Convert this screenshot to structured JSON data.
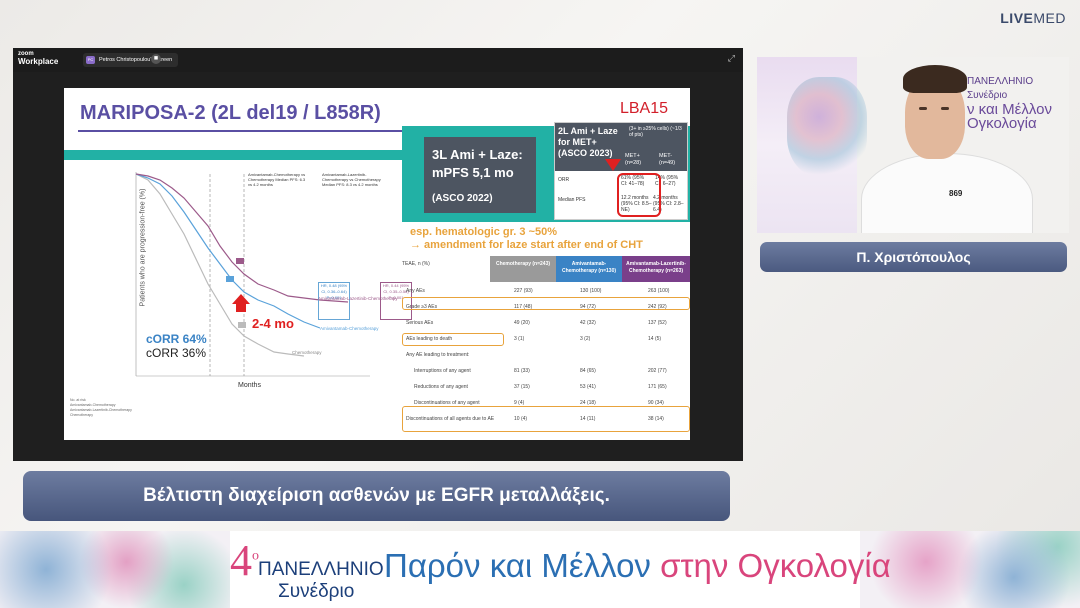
{
  "brand": {
    "logo_bold": "LIVE",
    "logo_light": "MED"
  },
  "zoom": {
    "app_logo_top": "zoom",
    "app_logo_bottom": "Workplace",
    "share_initials": "PC",
    "share_label": "Petros Christopoulou's screen",
    "stop_icon": "stop-icon",
    "expand_icon": "expand-icon"
  },
  "slide": {
    "title": "MARIPOSA-2 (2L del19 / L858R)",
    "lba": "LBA15",
    "box3l": {
      "line1": "3L Ami + Laze:",
      "line2": "mPFS 5,1 mo",
      "line3": "(ASCO 2022)"
    },
    "met": {
      "title": "2L Ami + Laze for MET+ (ASCO 2023)",
      "subtitle": "(3+ in ≥25% cells) (~1/3 of pts)",
      "col1": "MET+ (n=28)",
      "col2": "MET- (n=49)",
      "row1_label": "ORR",
      "row1_v1": "61% (95% CI: 41–78)",
      "row1_v2": "14% (95% CI: 6–27)",
      "row2_label": "Median PFS",
      "row2_v1": "12.2 months (95% CI: 8.5–NE)",
      "row2_v2": "4.2 months (95% CI: 2.8–6.4)"
    },
    "note": {
      "line1": "esp. hematologic gr. 3 ~50%",
      "line2": "→ amendment for laze start after end of CHT"
    },
    "km": {
      "ylabel": "Patients who are progression-free (%)",
      "xlabel": "Months",
      "corr1": "cORR 64%",
      "corr2": "cORR 36%",
      "mo": "2-4 mo",
      "leg1": "Amivantamab-Chemotherapy vs Chemotherapy Median PFS: 6.3 vs 4.2 months",
      "leg2": "Amivantamab-Lazertinib-Chemotherapy vs Chemotherapy Median PFS: 8.3 vs 4.2 months",
      "hr1": "HR, 0.48 (95% CI, 0.36–0.64) P<0.001",
      "hr2": "HR, 0.44 (95% CI, 0.35–0.56) P<0.001",
      "curve_alc": "Amivantamab-Lazertinib-Chemotherapy",
      "curve_ac": "Amivantamab-Chemotherapy",
      "curve_c": "Chemotherapy",
      "risk_title": "No. at risk",
      "risk_rows": [
        "Amivantamab-Chemotherapy",
        "Amivantamab-Lazertinib-Chemotherapy",
        "Chemotherapy"
      ]
    },
    "teae": {
      "h0": "TEAE, n (%)",
      "h1": "Chemotherapy (n=243)",
      "h2": "Amivantamab-Chemotherapy (n=130)",
      "h3": "Amivantamab-Lazertinib-Chemotherapy (n=263)",
      "rows": [
        [
          "Any AEs",
          "227 (93)",
          "130 (100)",
          "263 (100)"
        ],
        [
          "Grade ≥3 AEs",
          "117 (48)",
          "94 (72)",
          "242 (92)"
        ],
        [
          "Serious AEs",
          "49 (20)",
          "42 (32)",
          "137 (52)"
        ],
        [
          "AEs leading to death",
          "3 (1)",
          "3 (2)",
          "14 (5)"
        ],
        [
          "Any AE leading to treatment:",
          "",
          "",
          ""
        ],
        [
          "Interruptions of any agent",
          "81 (33)",
          "84 (65)",
          "202 (77)"
        ],
        [
          "Reductions of any agent",
          "37 (15)",
          "53 (41)",
          "171 (65)"
        ],
        [
          "Discontinuations of any agent",
          "9 (4)",
          "24 (18)",
          "90 (34)"
        ],
        [
          "Discontinuations of all agents due to AE",
          "10 (4)",
          "14 (11)",
          "38 (14)"
        ]
      ]
    }
  },
  "speaker": {
    "name": "Π. Χριστόπουλος",
    "wall_small": "ΠΑΝΕΛΛΗΝΙΟ Συνέδριο",
    "wall_line2": "ν και Μέλλον",
    "wall_line3": "Ογκολογία",
    "shirt_logo": "869"
  },
  "subtitle": "Βέλτιστη διαχείριση ασθενών με EGFR μεταλλάξεις.",
  "banner": {
    "num": "4",
    "sup": "ο",
    "line1": "ΠΑΝΕΛΛΗΝΙΟ",
    "line2": "Συνέδριο",
    "title_blue": "Παρόν και Μέλλον ",
    "title_pink": "στην Ογκολογία"
  },
  "colors": {
    "accent_purple": "#5a4fa3",
    "teal": "#22b1a5",
    "red": "#e02020",
    "orange": "#e8a33c",
    "bar_blue": "#4b5a80"
  }
}
